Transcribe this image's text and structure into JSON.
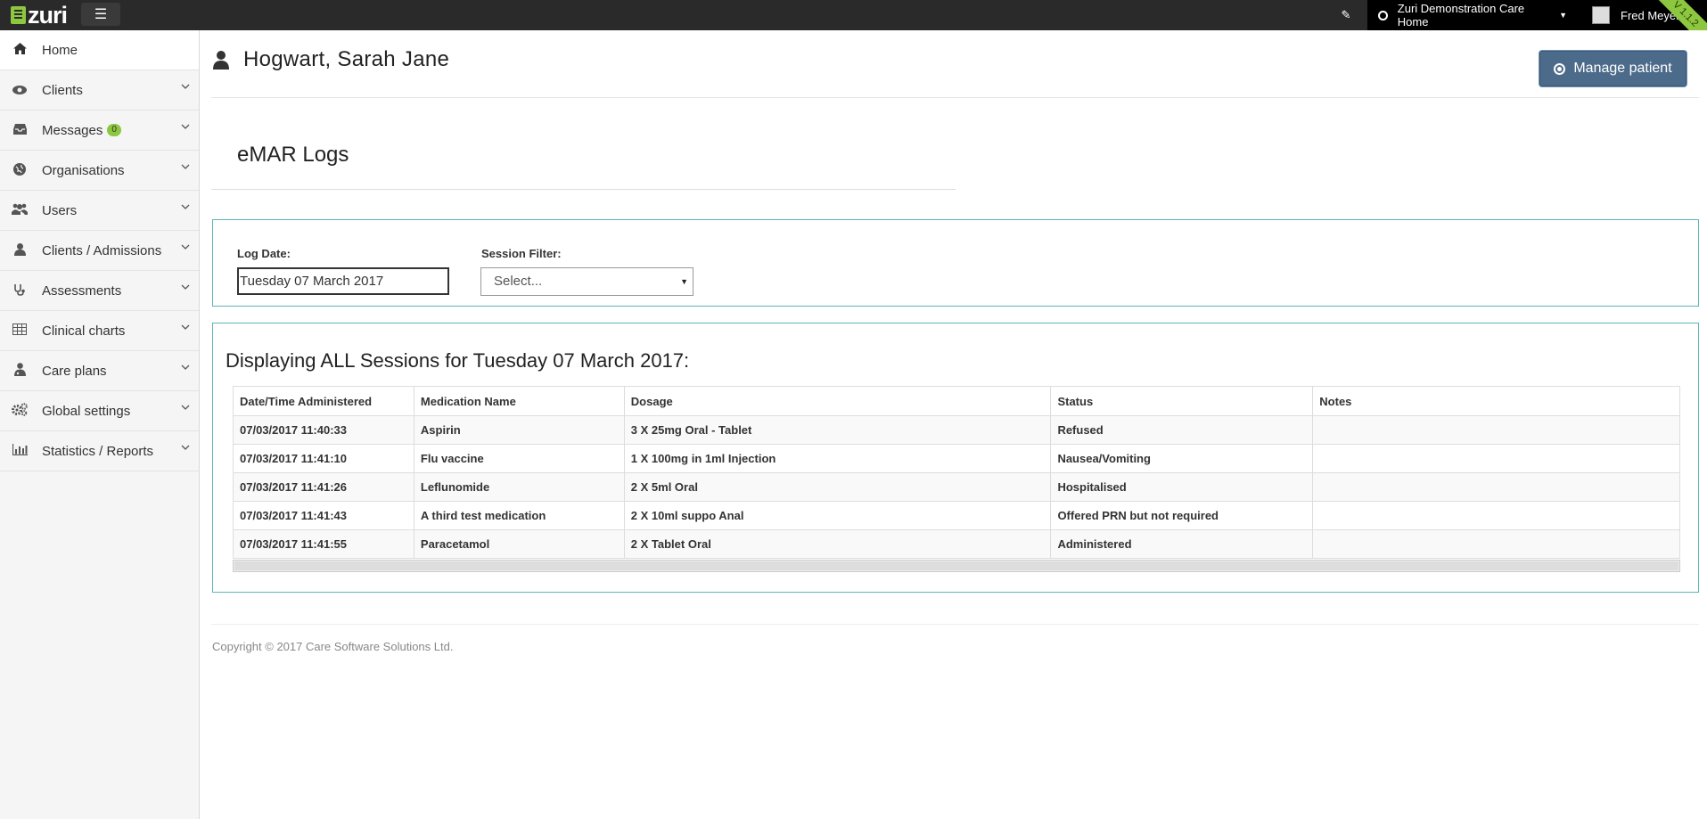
{
  "topbar": {
    "logo_text": "zuri",
    "organisation": "Zuri Demonstration Care Home",
    "user_name": "Fred Meyer",
    "version": "V 1.1.2"
  },
  "sidebar": {
    "items": [
      {
        "label": "Home",
        "icon": "home-icon"
      },
      {
        "label": "Clients",
        "icon": "eye-icon"
      },
      {
        "label": "Messages",
        "icon": "inbox-icon",
        "badge": "0"
      },
      {
        "label": "Organisations",
        "icon": "globe-icon"
      },
      {
        "label": "Users",
        "icon": "users-icon"
      },
      {
        "label": "Clients / Admissions",
        "icon": "user-icon"
      },
      {
        "label": "Assessments",
        "icon": "stethoscope-icon"
      },
      {
        "label": "Clinical charts",
        "icon": "table-icon"
      },
      {
        "label": "Care plans",
        "icon": "user-md-icon"
      },
      {
        "label": "Global settings",
        "icon": "cogs-icon"
      },
      {
        "label": "Statistics / Reports",
        "icon": "bar-chart-icon"
      }
    ]
  },
  "header": {
    "patient_name": "Hogwart, Sarah Jane",
    "manage_button": "Manage patient"
  },
  "main": {
    "section_title": "eMAR Logs",
    "filters": {
      "log_date_label": "Log Date:",
      "log_date_value": "Tuesday 07 March 2017",
      "session_label": "Session Filter:",
      "session_value": "Select..."
    },
    "results": {
      "heading": "Displaying ALL Sessions for Tuesday 07 March 2017:",
      "columns": [
        "Date/Time Administered",
        "Medication Name",
        "Dosage",
        "Status",
        "Notes"
      ],
      "rows": [
        [
          "07/03/2017 11:40:33",
          "Aspirin",
          "3 X 25mg Oral - Tablet",
          "Refused",
          ""
        ],
        [
          "07/03/2017 11:41:10",
          "Flu vaccine",
          "1 X 100mg in 1ml Injection",
          "Nausea/Vomiting",
          ""
        ],
        [
          "07/03/2017 11:41:26",
          "Leflunomide",
          "2 X 5ml Oral",
          "Hospitalised",
          ""
        ],
        [
          "07/03/2017 11:41:43",
          "A third test medication",
          "2 X 10ml suppo Anal",
          "Offered PRN but not required",
          ""
        ],
        [
          "07/03/2017 11:41:55",
          "Paracetamol",
          "2 X Tablet Oral",
          "Administered",
          ""
        ]
      ]
    }
  },
  "footer": {
    "copyright": "Copyright © 2017 Care Software Solutions Ltd."
  },
  "colors": {
    "topbar": "#2a2a2a",
    "accent_green": "#8dc63f",
    "panel_border": "#5bb5b7",
    "manage_button": "#4c6b8a"
  }
}
